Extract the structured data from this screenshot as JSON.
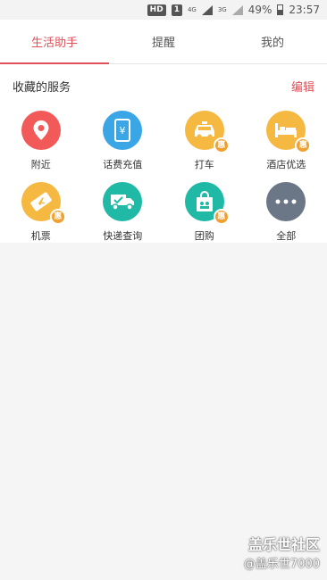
{
  "status_bar": {
    "hd": "HD",
    "sim": "1",
    "net1": "4G",
    "net2": "3G",
    "battery": "49%",
    "time": "23:57"
  },
  "tabs": [
    {
      "label": "生活助手",
      "active": true
    },
    {
      "label": "提醒",
      "active": false
    },
    {
      "label": "我的",
      "active": false
    }
  ],
  "favorites": {
    "title": "收藏的服务",
    "edit_label": "编辑",
    "items": [
      {
        "label": "附近",
        "icon": "location-pin-icon",
        "color": "#f25a5a",
        "badge": ""
      },
      {
        "label": "话费充值",
        "icon": "phone-recharge-icon",
        "color": "#3aa6e6",
        "badge": ""
      },
      {
        "label": "打车",
        "icon": "taxi-icon",
        "color": "#f5b942",
        "badge": "惠"
      },
      {
        "label": "酒店优选",
        "icon": "hotel-bed-icon",
        "color": "#f5b942",
        "badge": "惠"
      },
      {
        "label": "机票",
        "icon": "plane-ticket-icon",
        "color": "#f5b942",
        "badge": "惠"
      },
      {
        "label": "快递查询",
        "icon": "delivery-truck-icon",
        "color": "#1fb9a6",
        "badge": ""
      },
      {
        "label": "团购",
        "icon": "group-buy-bag-icon",
        "color": "#1fb9a6",
        "badge": "惠"
      },
      {
        "label": "全部",
        "icon": "more-dots-icon",
        "color": "#6b7686",
        "badge": ""
      }
    ]
  },
  "watermark": {
    "line1": "盖乐世社区",
    "line2": "@盖乐世7000"
  }
}
